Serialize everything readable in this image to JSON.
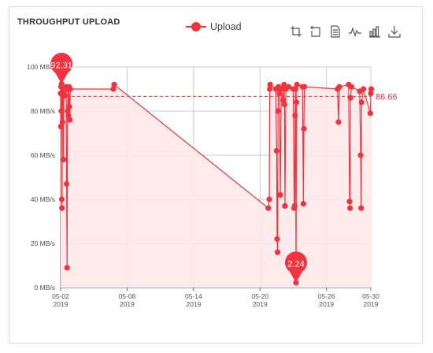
{
  "title": "THROUGHPUT UPLOAD",
  "legend": {
    "label": "Upload"
  },
  "toolbox": [
    "zoom-icon",
    "zoom-reset-icon",
    "data-view-icon",
    "line-view-icon",
    "bar-view-icon",
    "save-image-icon"
  ],
  "colors": {
    "series": "#f0333f",
    "area": "#fde8e9",
    "grid": "#cccccc",
    "axis": "#666666",
    "text": "#555555"
  },
  "chart_data": {
    "type": "area",
    "title": "THROUGHPUT UPLOAD",
    "xlabel": "",
    "ylabel": "",
    "ylim": [
      0,
      100
    ],
    "yticks": [
      {
        "value": 0,
        "label": "0 MB/s"
      },
      {
        "value": 20,
        "label": "20 MB/s"
      },
      {
        "value": 40,
        "label": "40 MB/s"
      },
      {
        "value": 60,
        "label": "60 MB/s"
      },
      {
        "value": 80,
        "label": "80 MB/s"
      },
      {
        "value": 100,
        "label": "100 MB/s"
      }
    ],
    "xlim": [
      "2019-05-02",
      "2019-05-30"
    ],
    "xticks": [
      {
        "date": "2019-05-02",
        "line1": "05-02",
        "line2": "2019"
      },
      {
        "date": "2019-05-08",
        "line1": "05-08",
        "line2": "2019"
      },
      {
        "date": "2019-05-14",
        "line1": "05-14",
        "line2": "2019"
      },
      {
        "date": "2019-05-20",
        "line1": "05-20",
        "line2": "2019"
      },
      {
        "date": "2019-05-26",
        "line1": "05-26",
        "line2": "2019"
      },
      {
        "date": "2019-05-30",
        "line1": "05-30",
        "line2": "2019"
      }
    ],
    "series": [
      {
        "name": "Upload",
        "points": [
          [
            "2019-05-02 00:00",
            88
          ],
          [
            "2019-05-02 00:30",
            73
          ],
          [
            "2019-05-02 01:00",
            91
          ],
          [
            "2019-05-02 01:30",
            80
          ],
          [
            "2019-05-02 02:00",
            92.31
          ],
          [
            "2019-05-02 02:30",
            40
          ],
          [
            "2019-05-02 03:00",
            36
          ],
          [
            "2019-05-02 03:30",
            88
          ],
          [
            "2019-05-02 04:00",
            75
          ],
          [
            "2019-05-02 05:00",
            91
          ],
          [
            "2019-05-02 06:00",
            58
          ],
          [
            "2019-05-02 07:00",
            90
          ],
          [
            "2019-05-02 09:00",
            87
          ],
          [
            "2019-05-02 12:00",
            91
          ],
          [
            "2019-05-02 13:00",
            47
          ],
          [
            "2019-05-02 14:00",
            9
          ],
          [
            "2019-05-02 15:00",
            80
          ],
          [
            "2019-05-02 16:00",
            90
          ],
          [
            "2019-05-02 17:00",
            78
          ],
          [
            "2019-05-02 18:00",
            91
          ],
          [
            "2019-05-02 19:00",
            82
          ],
          [
            "2019-05-02 20:00",
            76
          ],
          [
            "2019-05-02 21:00",
            90
          ],
          [
            "2019-05-06 18:00",
            90
          ],
          [
            "2019-05-06 20:00",
            92
          ],
          [
            "2019-05-20 18:00",
            36
          ],
          [
            "2019-05-20 20:00",
            40
          ],
          [
            "2019-05-20 21:00",
            90
          ],
          [
            "2019-05-20 22:00",
            92
          ],
          [
            "2019-05-21 10:00",
            90
          ],
          [
            "2019-05-21 12:00",
            62
          ],
          [
            "2019-05-21 13:00",
            22
          ],
          [
            "2019-05-21 14:00",
            16
          ],
          [
            "2019-05-21 15:00",
            80
          ],
          [
            "2019-05-21 16:00",
            91
          ],
          [
            "2019-05-21 18:00",
            88
          ],
          [
            "2019-05-21 20:00",
            42
          ],
          [
            "2019-05-21 22:00",
            90
          ],
          [
            "2019-05-22 02:00",
            85
          ],
          [
            "2019-05-22 04:00",
            92
          ],
          [
            "2019-05-22 05:00",
            83
          ],
          [
            "2019-05-22 06:00",
            37
          ],
          [
            "2019-05-22 08:00",
            90
          ],
          [
            "2019-05-22 14:00",
            91
          ],
          [
            "2019-05-23 00:00",
            90
          ],
          [
            "2019-05-23 02:00",
            36
          ],
          [
            "2019-05-23 03:00",
            37
          ],
          [
            "2019-05-23 04:00",
            78
          ],
          [
            "2019-05-23 05:00",
            90
          ],
          [
            "2019-05-23 06:00",
            2.24
          ],
          [
            "2019-05-23 07:00",
            84
          ],
          [
            "2019-05-23 08:00",
            92
          ],
          [
            "2019-05-23 20:00",
            91
          ],
          [
            "2019-05-23 22:00",
            38
          ],
          [
            "2019-05-23 23:00",
            72
          ],
          [
            "2019-05-24 00:00",
            91
          ],
          [
            "2019-05-27 00:00",
            90
          ],
          [
            "2019-05-27 02:00",
            75
          ],
          [
            "2019-05-27 04:00",
            91
          ],
          [
            "2019-05-28 00:00",
            92
          ],
          [
            "2019-05-28 02:00",
            39
          ],
          [
            "2019-05-28 03:00",
            36
          ],
          [
            "2019-05-28 04:00",
            86
          ],
          [
            "2019-05-28 06:00",
            91
          ],
          [
            "2019-05-29 00:00",
            89
          ],
          [
            "2019-05-29 02:00",
            60
          ],
          [
            "2019-05-29 03:00",
            36
          ],
          [
            "2019-05-29 04:00",
            84
          ],
          [
            "2019-05-29 08:00",
            90
          ],
          [
            "2019-05-29 23:00",
            79
          ],
          [
            "2019-05-30 00:00",
            88
          ],
          [
            "2019-05-30 01:00",
            90
          ]
        ]
      }
    ],
    "markPoints": [
      {
        "label": "92.31",
        "date": "2019-05-02 02:00",
        "value": 92.31,
        "type": "max"
      },
      {
        "label": "2.24",
        "date": "2019-05-23 06:00",
        "value": 2.24,
        "type": "min"
      }
    ],
    "markLine": {
      "label": "86.66",
      "value": 86.66,
      "type": "average"
    },
    "grid": true,
    "legend_position": "top-center"
  }
}
